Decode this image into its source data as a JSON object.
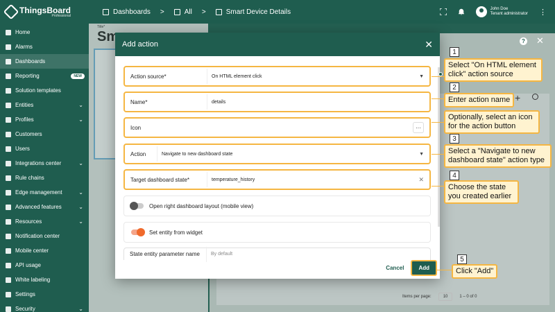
{
  "app": {
    "logo_name": "ThingsBoard",
    "logo_sub": "Professional"
  },
  "sidebar": {
    "items": [
      {
        "label": "Home",
        "icon": "home-icon"
      },
      {
        "label": "Alarms",
        "icon": "alarm-icon"
      },
      {
        "label": "Dashboards",
        "icon": "dashboard-icon",
        "active": true
      },
      {
        "label": "Reporting",
        "icon": "report-icon",
        "badge": "NEW"
      },
      {
        "label": "Solution templates",
        "icon": "template-icon"
      },
      {
        "label": "Entities",
        "icon": "entities-icon",
        "chevron": true
      },
      {
        "label": "Profiles",
        "icon": "profiles-icon",
        "chevron": true
      },
      {
        "label": "Customers",
        "icon": "customers-icon"
      },
      {
        "label": "Users",
        "icon": "users-icon"
      },
      {
        "label": "Integrations center",
        "icon": "integrations-icon",
        "chevron": true
      },
      {
        "label": "Rule chains",
        "icon": "rule-chains-icon"
      },
      {
        "label": "Edge management",
        "icon": "edge-icon",
        "chevron": true
      },
      {
        "label": "Advanced features",
        "icon": "advanced-icon",
        "chevron": true
      },
      {
        "label": "Resources",
        "icon": "resources-icon",
        "chevron": true
      },
      {
        "label": "Notification center",
        "icon": "notification-icon"
      },
      {
        "label": "Mobile center",
        "icon": "mobile-icon"
      },
      {
        "label": "API usage",
        "icon": "api-icon"
      },
      {
        "label": "White labeling",
        "icon": "white-label-icon"
      },
      {
        "label": "Settings",
        "icon": "settings-icon"
      },
      {
        "label": "Security",
        "icon": "security-icon",
        "chevron": true
      }
    ]
  },
  "breadcrumb": {
    "c1": "Dashboards",
    "c2": "All",
    "c3": "Smart Device Details",
    "sep": ">"
  },
  "user": {
    "name": "John Doe",
    "role": "Tenant administrator"
  },
  "background": {
    "title_small": "Title*",
    "title_big": "Sm",
    "table_items_per_page": "Items per page:",
    "table_page_size": "10",
    "table_range": "1 – 0 of 0"
  },
  "dialog": {
    "title": "Add action",
    "fields": {
      "action_source": {
        "label": "Action source*",
        "value": "On HTML element click"
      },
      "name": {
        "label": "Name*",
        "value": "details"
      },
      "icon": {
        "label": "Icon",
        "more": "···"
      },
      "action": {
        "label": "Action",
        "value": "Navigate to new dashboard state"
      },
      "target_state": {
        "label": "Target dashboard state*",
        "value": "temperature_history"
      },
      "open_right_layout": {
        "label": "Open right dashboard layout (mobile view)",
        "on": false
      },
      "set_entity": {
        "label": "Set entity from widget",
        "on": true
      },
      "state_entity_param": {
        "label": "State entity parameter name",
        "placeholder": "By default"
      }
    },
    "cancel": "Cancel",
    "add": "Add"
  },
  "callouts": [
    {
      "num": "1",
      "text": "Select \"On HTML element click\" action source"
    },
    {
      "num": "2",
      "text": "Enter action name"
    },
    {
      "num": "",
      "text": "Optionally, select an icon for the action button"
    },
    {
      "num": "3",
      "text": "Select a \"Navigate to new dashboard state\" action type"
    },
    {
      "num": "4",
      "text": "Choose the state you created earlier"
    },
    {
      "num": "5",
      "text": "Click \"Add\""
    }
  ],
  "colors": {
    "primary": "#1f5d4f",
    "highlight": "#f5b642",
    "toggle_on": "#f06a2c"
  }
}
